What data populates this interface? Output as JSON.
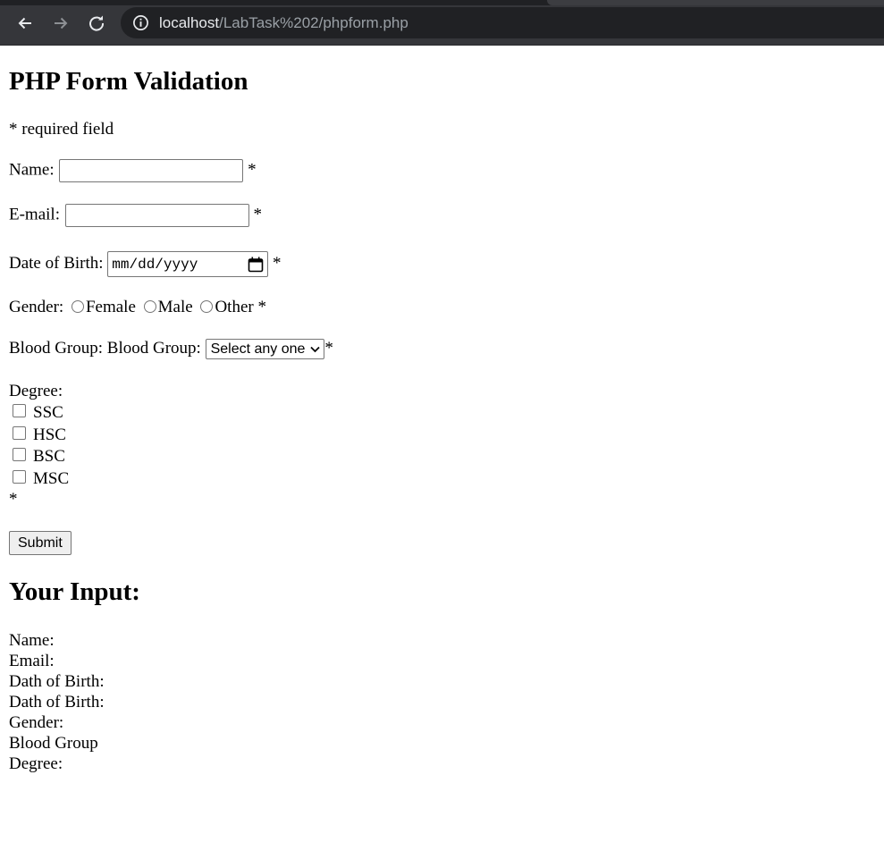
{
  "browser": {
    "url_host": "localhost",
    "url_path": "/LabTask%202/phpform.php",
    "icons": [
      "back-arrow-icon",
      "forward-arrow-icon",
      "reload-icon",
      "info-icon"
    ]
  },
  "form": {
    "title": "PHP Form Validation",
    "required_note": "* required field",
    "name_label": "Name:",
    "name_value": "",
    "email_label": "E-mail:",
    "email_value": "",
    "dob_label": "Date of Birth:",
    "dob_placeholder": "mm/dd/yyyy",
    "gender_label": "Gender:",
    "gender_options": [
      "Female",
      "Male",
      "Other"
    ],
    "blood_group_label": "Blood Group: Blood Group:",
    "blood_group_selected": "Select any one",
    "degree_label": "Degree:",
    "degree_options": [
      "SSC",
      "HSC",
      "BSC",
      "MSC"
    ],
    "required_marker": "*",
    "submit_label": "Submit"
  },
  "output": {
    "title": "Your Input:",
    "lines": [
      "Name:",
      "Email:",
      "Dath of Birth:",
      "Dath of Birth:",
      "Gender:",
      "Blood Group",
      "Degree:"
    ]
  }
}
